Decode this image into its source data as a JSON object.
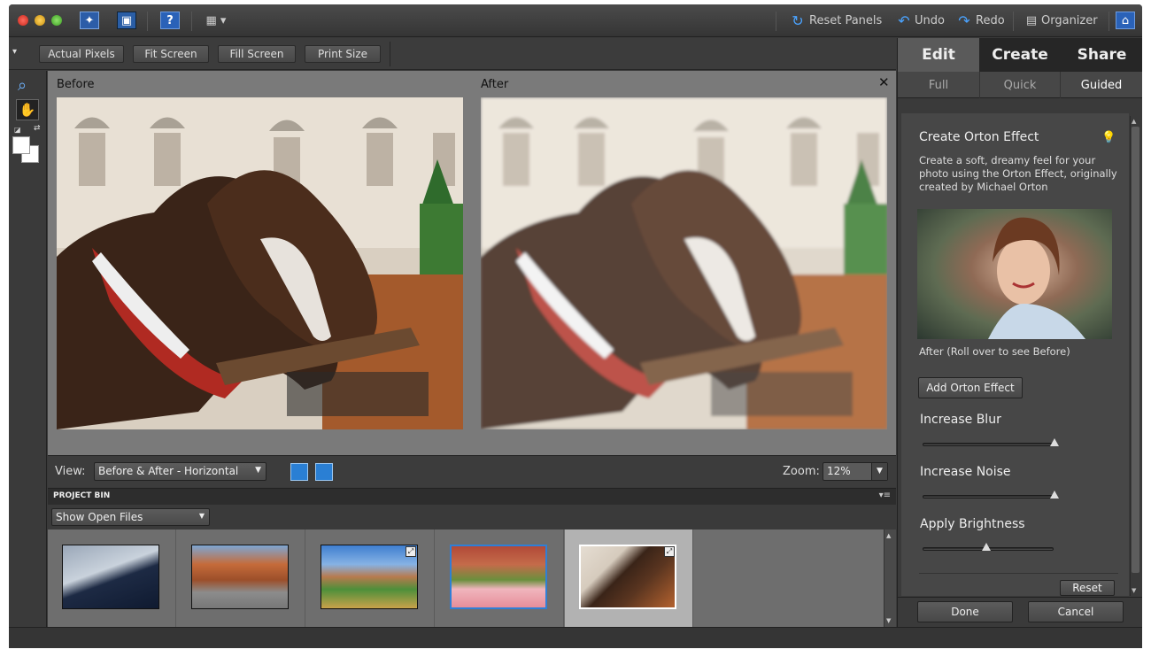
{
  "top_toolbar": {
    "reset_panels": "Reset Panels",
    "undo": "Undo",
    "redo": "Redo",
    "organizer": "Organizer"
  },
  "view_buttons": [
    "Actual Pixels",
    "Fit Screen",
    "Fill Screen",
    "Print Size"
  ],
  "canvas": {
    "before_label": "Before",
    "after_label": "After"
  },
  "view_bar": {
    "view_label": "View:",
    "view_value": "Before & After - Horizontal",
    "zoom_label": "Zoom:",
    "zoom_value": "12%"
  },
  "project_bin": {
    "title": "PROJECT BIN",
    "filter_value": "Show Open Files",
    "thumbnail_count": 5,
    "selected_index": 4
  },
  "right_panel": {
    "tabs": [
      "Edit",
      "Create",
      "Share"
    ],
    "subtabs": [
      "Full",
      "Quick",
      "Guided"
    ],
    "active_tab": "Edit",
    "active_subtab": "Guided",
    "title": "Create Orton Effect",
    "description": "Create a soft, dreamy feel for your photo using the Orton Effect, originally created by Michael Orton",
    "preview_caption": "After (Roll over to see Before)",
    "add_button": "Add Orton Effect",
    "sliders": [
      {
        "label": "Increase Blur",
        "value": 1.0
      },
      {
        "label": "Increase Noise",
        "value": 1.0
      },
      {
        "label": "Apply Brightness",
        "value": 0.5
      }
    ],
    "reset": "Reset",
    "done": "Done",
    "cancel": "Cancel"
  },
  "colors": {
    "accent_blue": "#2f7fd6",
    "panel_bg": "#3a3a3a"
  }
}
